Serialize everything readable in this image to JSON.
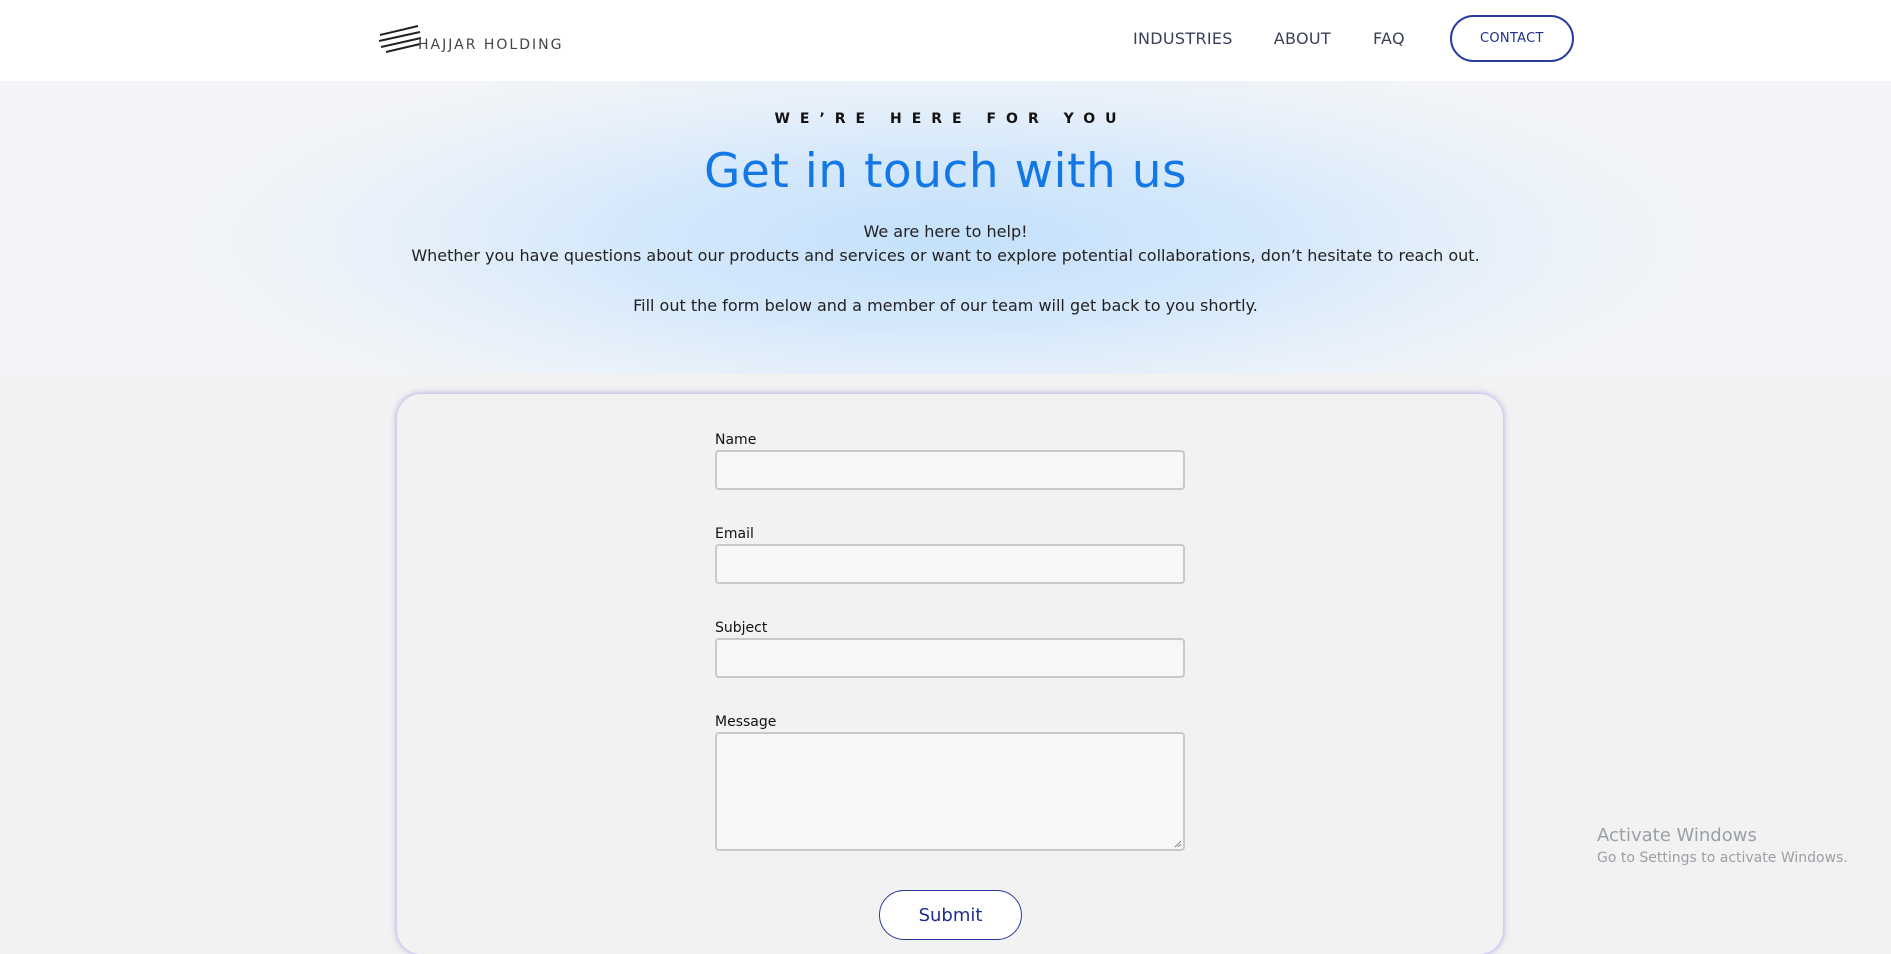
{
  "header": {
    "logo_text": "HAJJAR HOLDING",
    "nav": {
      "industries": "INDUSTRIES",
      "about": "ABOUT",
      "faq": "FAQ"
    },
    "contact_label": "CONTACT"
  },
  "hero": {
    "eyebrow": "WE’RE HERE FOR YOU",
    "title": "Get in touch with us",
    "line1": "We are here to help!",
    "line2": "Whether you have questions about our products and services or want to explore potential collaborations, don’t hesitate to reach out.",
    "line3": "Fill out the form below and a member of our team will get back to you shortly."
  },
  "form": {
    "name_label": "Name",
    "name_value": "",
    "email_label": "Email",
    "email_value": "",
    "subject_label": "Subject",
    "subject_value": "",
    "message_label": "Message",
    "message_value": "",
    "submit_label": "Submit"
  },
  "os_overlay": {
    "title": "Activate Windows",
    "subtitle": "Go to Settings to activate Windows."
  },
  "colors": {
    "accent_blue": "#1477e6",
    "button_navy": "#1f2d8c",
    "page_bg": "#f2f2f2"
  }
}
